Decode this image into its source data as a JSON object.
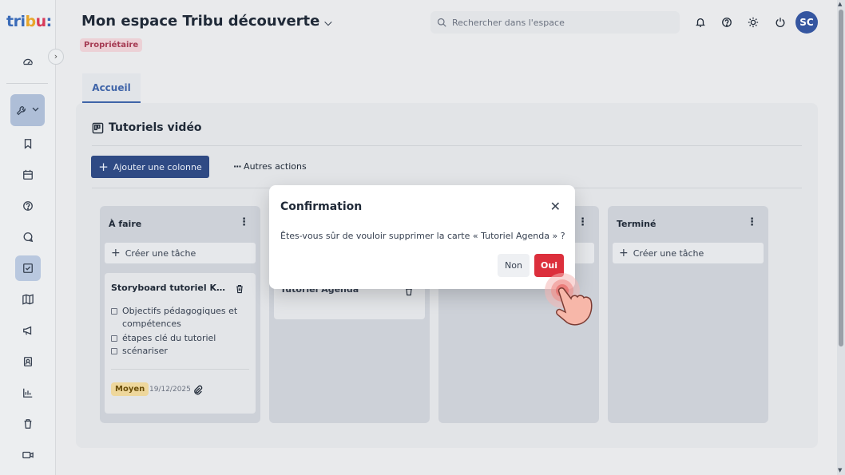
{
  "logo": {
    "t1": "tri",
    "t2": "b",
    "t3": "u",
    "colon": ":"
  },
  "header": {
    "space_title": "Mon espace Tribu découverte",
    "role_badge": "Propriétaire",
    "search_placeholder": "Rechercher dans l'espace",
    "avatar_initials": "SC"
  },
  "tabs": [
    {
      "label": "Accueil"
    }
  ],
  "board": {
    "section_title": "Tutoriels vidéo",
    "add_column_label": "Ajouter une colonne",
    "more_actions_label": "Autres actions",
    "columns": [
      {
        "title": "À faire",
        "create_label": "Créer une tâche"
      },
      {
        "title": "",
        "create_label": ""
      },
      {
        "title": "",
        "create_label": ""
      },
      {
        "title": "Terminé",
        "create_label": "Créer une tâche"
      }
    ],
    "card1": {
      "title": "Storyboard tutoriel Kanb...",
      "checklist": [
        "Objectifs pédagogiques et compétences",
        "étapes clé du tutoriel",
        "scénariser"
      ],
      "priority": "Moyen",
      "date": "19/12/2025"
    },
    "card2": {
      "title": "Tutoriel Agenda"
    }
  },
  "modal": {
    "title": "Confirmation",
    "message": "Êtes-vous sûr de vouloir supprimer la carte « Tutoriel Agenda » ?",
    "no_label": "Non",
    "yes_label": "Oui"
  },
  "colors": {
    "primary": "#2f4a84",
    "accent": "#3f64a8",
    "danger": "#dc2f3c",
    "badge_bg": "#ecd1d6",
    "priority_bg": "#eed79c"
  }
}
